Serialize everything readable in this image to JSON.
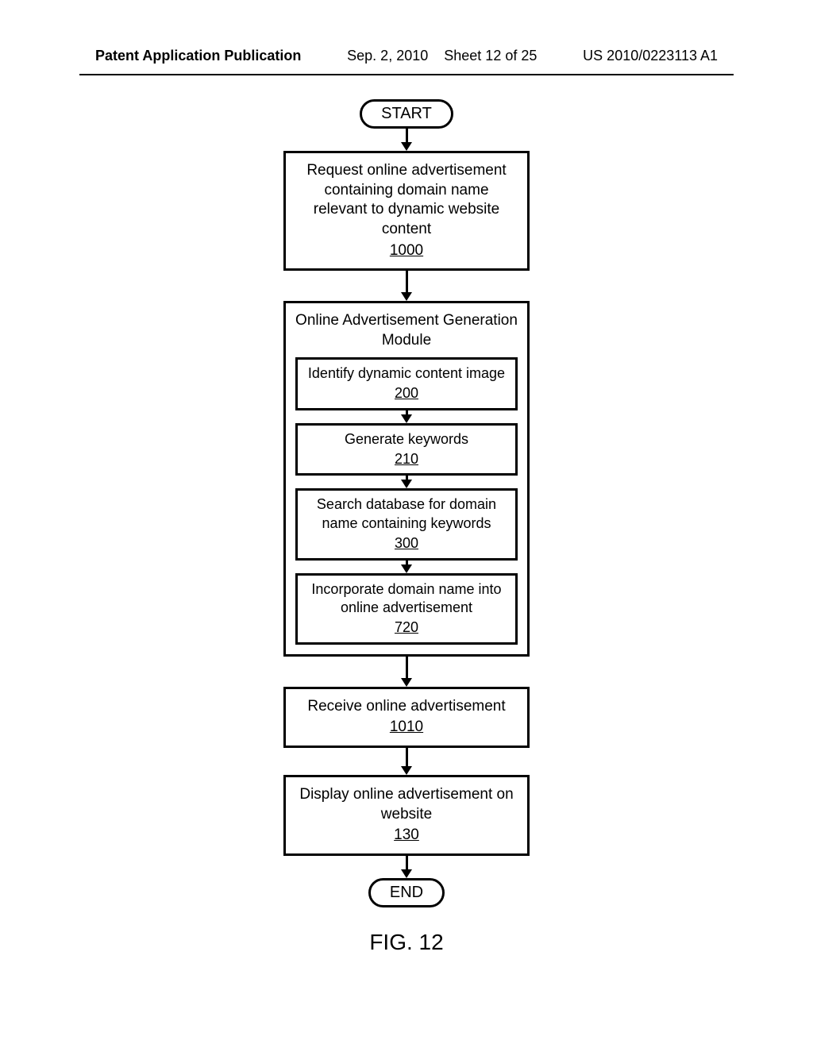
{
  "header": {
    "left": "Patent Application Publication",
    "center_date": "Sep. 2, 2010",
    "center_sheet": "Sheet 12 of 25",
    "right": "US 2010/0223113 A1"
  },
  "flow": {
    "start": "START",
    "end": "END",
    "step1": {
      "text": "Request online advertisement containing domain name relevant to dynamic website content",
      "ref": "1000"
    },
    "module": {
      "title": "Online Advertisement Generation Module",
      "sub1": {
        "text": "Identify dynamic content image",
        "ref": "200"
      },
      "sub2": {
        "text": "Generate keywords",
        "ref": "210"
      },
      "sub3": {
        "text": "Search database for domain name containing keywords",
        "ref": "300"
      },
      "sub4": {
        "text": "Incorporate domain name into online advertisement",
        "ref": "720"
      }
    },
    "step3": {
      "text": "Receive online advertisement",
      "ref": "1010"
    },
    "step4": {
      "text": "Display online advertisement on website",
      "ref": "130"
    }
  },
  "caption": "FIG. 12"
}
